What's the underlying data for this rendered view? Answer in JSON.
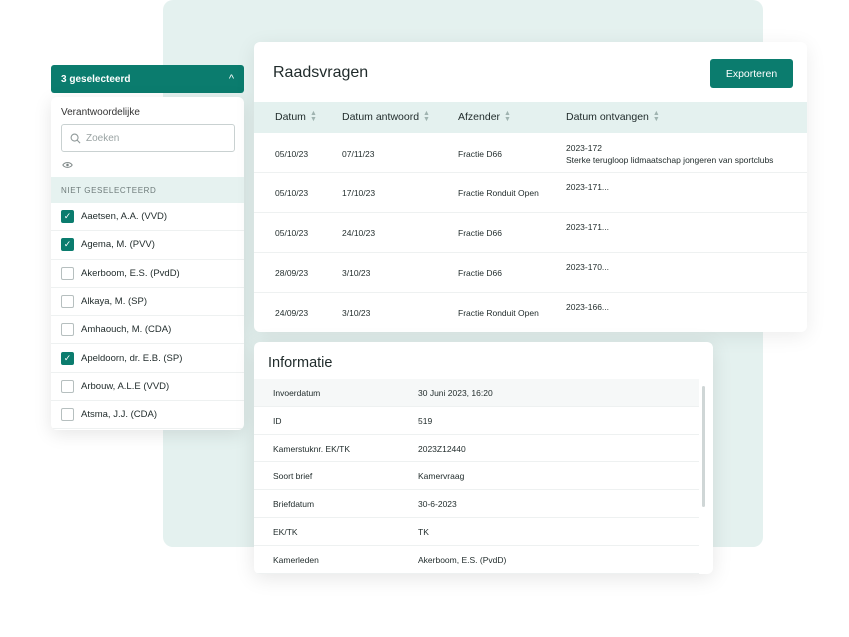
{
  "filter": {
    "header_label": "3 geselecteerd",
    "chevron": "^",
    "label": "Verantwoordelijke",
    "search_placeholder": "Zoeken",
    "section_label": "NIET GESELECTEERD",
    "options": [
      {
        "label": "Aaetsen, A.A. (VVD)",
        "checked": true
      },
      {
        "label": "Agema, M. (PVV)",
        "checked": true
      },
      {
        "label": "Akerboom, E.S. (PvdD)",
        "checked": false
      },
      {
        "label": "Alkaya, M. (SP)",
        "checked": false
      },
      {
        "label": "Amhaouch, M. (CDA)",
        "checked": false
      },
      {
        "label": "Apeldoorn, dr. E.B. (SP)",
        "checked": true
      },
      {
        "label": "Arbouw, A.L.E (VVD)",
        "checked": false
      },
      {
        "label": "Atsma, J.J. (CDA)",
        "checked": false
      }
    ]
  },
  "raadsvragen": {
    "title": "Raadsvragen",
    "export_label": "Exporteren",
    "columns": [
      "Datum",
      "Datum antwoord",
      "Afzender",
      "Datum ontvangen"
    ],
    "rows": [
      {
        "datum": "05/10/23",
        "antwoord": "07/11/23",
        "afzender": "Fractie D66",
        "ontvangen": "2023-172",
        "ontvangen_sub": "Sterke terugloop lidmaatschap jongeren van sportclubs"
      },
      {
        "datum": "05/10/23",
        "antwoord": "17/10/23",
        "afzender": "Fractie Ronduit Open",
        "ontvangen": "2023-171...",
        "ontvangen_sub": ""
      },
      {
        "datum": "05/10/23",
        "antwoord": "24/10/23",
        "afzender": "Fractie D66",
        "ontvangen": "2023-171...",
        "ontvangen_sub": ""
      },
      {
        "datum": "28/09/23",
        "antwoord": "3/10/23",
        "afzender": "Fractie D66",
        "ontvangen": "2023-170...",
        "ontvangen_sub": ""
      },
      {
        "datum": "24/09/23",
        "antwoord": "3/10/23",
        "afzender": "Fractie Ronduit Open",
        "ontvangen": "2023-166...",
        "ontvangen_sub": ""
      }
    ]
  },
  "informatie": {
    "title": "Informatie",
    "rows": [
      {
        "key": "Invoerdatum",
        "value": "30 Juni 2023, 16:20"
      },
      {
        "key": "ID",
        "value": "519"
      },
      {
        "key": "Kamerstuknr. EK/TK",
        "value": "2023Z12440"
      },
      {
        "key": "Soort brief",
        "value": "Kamervraag"
      },
      {
        "key": "Briefdatum",
        "value": "30-6-2023"
      },
      {
        "key": "EK/TK",
        "value": "TK"
      },
      {
        "key": "Kamerleden",
        "value": "Akerboom, E.S. (PvdD)"
      }
    ]
  },
  "colors": {
    "accent": "#0b7c6e",
    "accent_light": "#e4f1ef"
  }
}
